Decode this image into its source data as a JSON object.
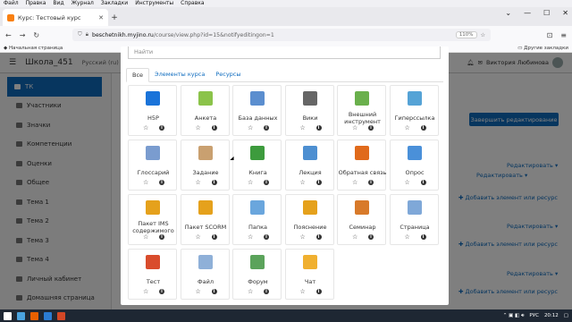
{
  "browser": {
    "menu": [
      "Файл",
      "Правка",
      "Вид",
      "Журнал",
      "Закладки",
      "Инструменты",
      "Справка"
    ],
    "tab_title": "Курс: Тестовый курс",
    "url_host": "beschetnikh.myjino.ru",
    "url_path": "/course/view.php?id=15&notifyeditingon=1",
    "zoom": "110%",
    "bookmark_home": "Начальная страница",
    "bookmark_other": "Другие закладки"
  },
  "moodle": {
    "site": "Школа_451",
    "lang": "Русский (ru)",
    "user": "Виктория Любимова"
  },
  "sidebar": {
    "items": [
      {
        "label": "ТК",
        "active": true
      },
      {
        "label": "Участники"
      },
      {
        "label": "Значки"
      },
      {
        "label": "Компетенции"
      },
      {
        "label": "Оценки"
      },
      {
        "label": "Общее"
      },
      {
        "label": "Тема 1"
      },
      {
        "label": "Тема 2"
      },
      {
        "label": "Тема 3"
      },
      {
        "label": "Тема 4"
      },
      {
        "label": "Личный кабинет"
      },
      {
        "label": "Домашняя страница"
      }
    ]
  },
  "page": {
    "edit_button": "Завершить редактирование",
    "edit_link": "Редактировать",
    "add_link": "Добавить элемент или ресурс"
  },
  "modal": {
    "search_placeholder": "Найти",
    "tabs": [
      "Все",
      "Элементы курса",
      "Ресурсы"
    ],
    "cards": [
      {
        "label": "H5P",
        "color": "#1a73d9",
        "icon": "h5p-icon"
      },
      {
        "label": "Анкета",
        "color": "#8bc34a",
        "icon": "survey-icon"
      },
      {
        "label": "База данных",
        "color": "#5b8ecf",
        "icon": "database-icon"
      },
      {
        "label": "Вики",
        "color": "#666666",
        "icon": "wiki-icon"
      },
      {
        "label": "Внешний инструмент",
        "color": "#6ab04c",
        "icon": "lti-icon"
      },
      {
        "label": "Гиперссылка",
        "color": "#55a3d6",
        "icon": "url-icon"
      },
      {
        "label": "Глоссарий",
        "color": "#7a9ccf",
        "icon": "glossary-icon"
      },
      {
        "label": "Задание",
        "color": "#c9a070",
        "icon": "assign-icon"
      },
      {
        "label": "Книга",
        "color": "#3d9b3d",
        "icon": "book-icon"
      },
      {
        "label": "Лекция",
        "color": "#4d8fd1",
        "icon": "lesson-icon"
      },
      {
        "label": "Обратная связь",
        "color": "#e06a1b",
        "icon": "feedback-icon"
      },
      {
        "label": "Опрос",
        "color": "#4a90d9",
        "icon": "choice-icon"
      },
      {
        "label": "Пакет IMS содержимого",
        "color": "#e5a11c",
        "icon": "imscp-icon"
      },
      {
        "label": "Пакет SCORM",
        "color": "#e5a11c",
        "icon": "scorm-icon"
      },
      {
        "label": "Папка",
        "color": "#6aa6dd",
        "icon": "folder-icon"
      },
      {
        "label": "Пояснение",
        "color": "#e5a11c",
        "icon": "label-icon"
      },
      {
        "label": "Семинар",
        "color": "#d87a2a",
        "icon": "workshop-icon"
      },
      {
        "label": "Страница",
        "color": "#7fa8d8",
        "icon": "page-icon"
      },
      {
        "label": "Тест",
        "color": "#d94c2c",
        "icon": "quiz-icon"
      },
      {
        "label": "Файл",
        "color": "#8fb0d8",
        "icon": "file-icon"
      },
      {
        "label": "Форум",
        "color": "#5ba35b",
        "icon": "forum-icon"
      },
      {
        "label": "Чат",
        "color": "#f0b030",
        "icon": "chat-icon"
      }
    ]
  },
  "taskbar": {
    "lang": "РУС",
    "time": "20:12"
  }
}
